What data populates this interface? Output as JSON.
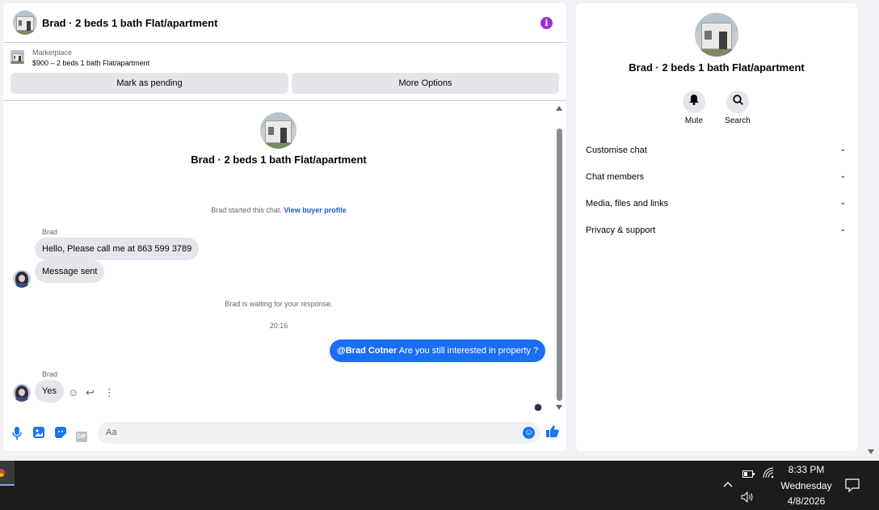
{
  "header": {
    "title": "Brad · 2 beds 1 bath Flat/apartment",
    "info_icon": "i"
  },
  "listing": {
    "label": "Marketplace",
    "description": "$900 – 2 beds 1 bath Flat/apartment",
    "mark_pending": "Mark as pending",
    "more_options": "More Options"
  },
  "conversation": {
    "name": "Brad · 2 beds 1 bath Flat/apartment",
    "started_text": "Brad started this chat. ",
    "view_profile": "View buyer profile",
    "sender_1": "Brad",
    "msg_1": "Hello, Please call me at 863 599 3789",
    "msg_2": "Message sent",
    "waiting": "Brad is waiting for your response.",
    "timestamp": "20:16",
    "out_mention": "@Brad Cotner",
    "out_text": " Are you still interested in property ?",
    "sender_2": "Brad",
    "msg_3": "Yes"
  },
  "composer": {
    "placeholder": "Aa",
    "gif_label": "GIF"
  },
  "info_panel": {
    "name": "Brad · 2 beds 1 bath Flat/apartment",
    "mute_label": "Mute",
    "search_label": "Search",
    "menu": [
      "Customise chat",
      "Chat members",
      "Media, files and links",
      "Privacy & support"
    ]
  },
  "taskbar": {
    "time": "8:33 PM",
    "day": "Wednesday",
    "date": "4/8/2026"
  },
  "colors": {
    "accent": "#1877f2",
    "outgoing_bubble": "#1b6ef3",
    "info_purple": "#9b2fd1"
  }
}
